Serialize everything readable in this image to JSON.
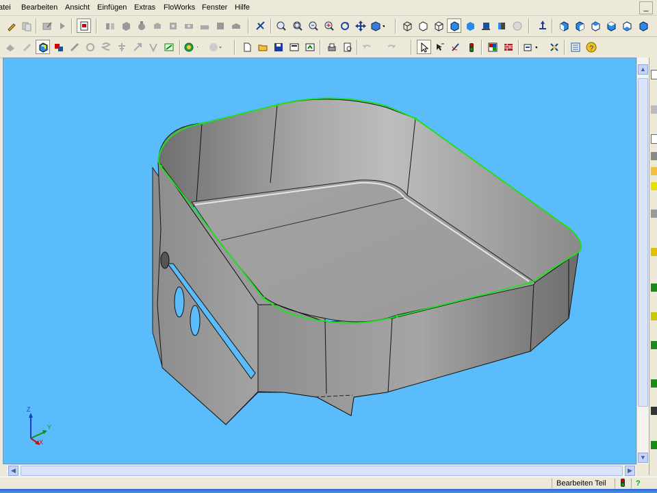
{
  "menubar": {
    "items": [
      "atei",
      "Bearbeiten",
      "Ansicht",
      "Einfügen",
      "Extras",
      "FloWorks",
      "Fenster",
      "Hilfe"
    ],
    "window_minimize": "_"
  },
  "toolbar1": {
    "icons": [
      "sketch-pencil-icon",
      "copy-icon",
      "edit-sketch-icon",
      "play-icon",
      "part-properties-icon",
      "mirror-icon",
      "cube-gray-icon",
      "dome-icon",
      "shell-icon",
      "wrap-icon",
      "hole-icon",
      "cut-icon",
      "box-gray-icon",
      "extrude-gray-icon",
      "smart-dimension-icon",
      "zoom-fit-icon",
      "zoom-window-icon",
      "zoom-in-out-icon",
      "zoom-selection-icon",
      "rotate-view-icon",
      "pan-icon",
      "standard-views-icon",
      "wireframe-icon",
      "hidden-lines-visible-icon",
      "hidden-lines-removed-icon",
      "shaded-edges-icon",
      "shaded-icon",
      "shadow-icon",
      "section-view-icon",
      "realview-icon",
      "normal-to-icon",
      "front-view-icon",
      "back-view-icon",
      "left-view-icon",
      "right-view-icon",
      "top-view-icon"
    ]
  },
  "toolbar2": {
    "icons": [
      "feature-a-icon",
      "feature-b-icon",
      "rebuild-icon",
      "assembly-icon",
      "measure-icon",
      "loop-icon",
      "spring-icon",
      "tree-icon",
      "move-icon",
      "mate-icon",
      "globe-icon",
      "material-icon",
      "new-document-icon",
      "open-folder-icon",
      "save-icon",
      "print-preview-a-icon",
      "print-preview-b-icon",
      "print-icon",
      "preview-icon",
      "undo-icon",
      "redo-icon",
      "select-arrow-icon",
      "select-filter-icon",
      "sketch-edit-icon",
      "traffic-light-icon",
      "grid-icon",
      "brick-icon",
      "options-icon",
      "macro-icon",
      "list-icon",
      "help-icon"
    ]
  },
  "viewport": {
    "background": "#5bbcfc",
    "model_color": "#a9a9a9",
    "edge_highlight": "#22dd22",
    "triad": {
      "z": "Z",
      "y": "Y",
      "x": "X"
    }
  },
  "statusbar": {
    "mode_text": "Bearbeiten Teil",
    "help_badge": "?"
  }
}
